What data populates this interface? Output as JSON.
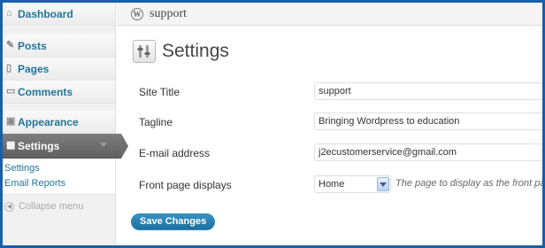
{
  "sidebar": {
    "items": [
      {
        "label": "Dashboard",
        "icon": "dashboard-icon"
      },
      {
        "label": "Posts",
        "icon": "posts-icon"
      },
      {
        "label": "Pages",
        "icon": "pages-icon"
      },
      {
        "label": "Comments",
        "icon": "comments-icon"
      },
      {
        "label": "Appearance",
        "icon": "appearance-icon"
      },
      {
        "label": "Settings",
        "icon": "settings-icon",
        "current": true
      }
    ],
    "submenu": [
      "Settings",
      "Email Reports"
    ],
    "collapse_label": "Collapse menu"
  },
  "header": {
    "site_name": "support"
  },
  "page": {
    "title": "Settings"
  },
  "form": {
    "site_title": {
      "label": "Site Title",
      "value": "support"
    },
    "tagline": {
      "label": "Tagline",
      "value": "Bringing Wordpress to education"
    },
    "email": {
      "label": "E-mail address",
      "value": "j2ecustomerservice@gmail.com"
    },
    "front_page": {
      "label": "Front page displays",
      "selected": "Home",
      "hint": "The page to display as the front page"
    }
  },
  "save_label": "Save Changes",
  "colors": {
    "frame": "#1a5fa8",
    "link": "#21759b",
    "current_menu": "#6e6e6e",
    "button": "#21759b"
  }
}
